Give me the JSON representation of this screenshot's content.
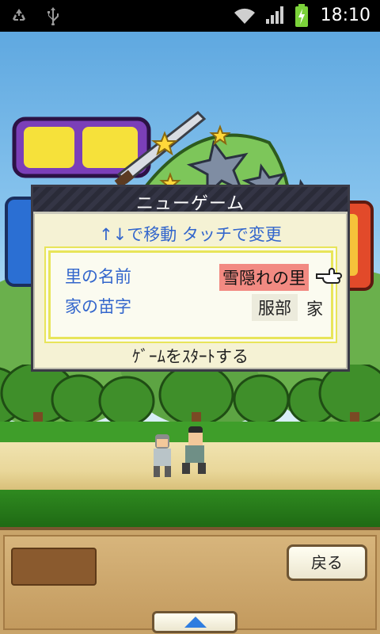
{
  "status_bar": {
    "time": "18:10",
    "icons": [
      "recycle-icon",
      "usb-icon",
      "wifi-icon",
      "signal-icon",
      "battery-charging-icon"
    ]
  },
  "dialog": {
    "title": "ニューゲーム",
    "instructions": "↑↓で移動 タッチで変更",
    "rows": [
      {
        "label": "里の名前",
        "value": "雪隠れの里"
      },
      {
        "label": "家の苗字",
        "value": "服部",
        "suffix": "家"
      }
    ],
    "start_label": "ｹﾞｰﾑをｽﾀｰﾄする"
  },
  "bottom_panel": {
    "back_label": "戻る"
  },
  "colors": {
    "highlight": "#f28a82",
    "label_blue": "#3366cc",
    "inner_border": "#e8e55a",
    "up_arrow": "#2f7de0"
  }
}
